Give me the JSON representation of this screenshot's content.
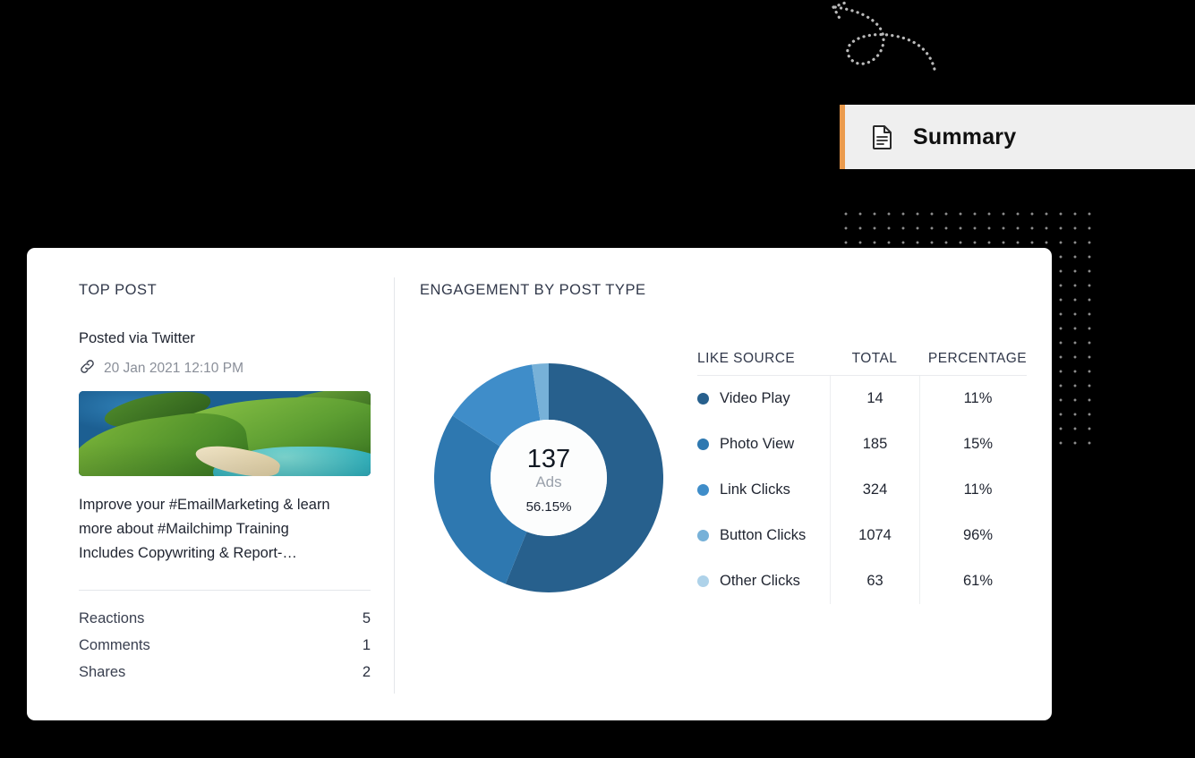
{
  "summary_tab": {
    "label": "Summary",
    "icon": "document-icon",
    "accent_color": "#eb9b4d",
    "background": "#efefef"
  },
  "card": {
    "top_post": {
      "title": "TOP POST",
      "posted_via": "Posted via Twitter",
      "link_icon": "link-icon",
      "date": "20 Jan 2021 12:10 PM",
      "thumbnail_alt": "aerial-coastline-photo",
      "text": "Improve your #EmailMarketing & learn more about #Mailchimp Training Includes Copywriting & Report-…",
      "stats": [
        {
          "label": "Reactions",
          "value": "5"
        },
        {
          "label": "Comments",
          "value": "1"
        },
        {
          "label": "Shares",
          "value": "2"
        }
      ]
    },
    "engagement": {
      "title": "ENGAGEMENT BY POST TYPE",
      "donut_center": {
        "value": "137",
        "label": "Ads",
        "percent": "56.15%"
      },
      "table": {
        "headers": {
          "source": "LIKE SOURCE",
          "total": "TOTAL",
          "percentage": "PERCENTAGE"
        },
        "rows": [
          {
            "label": "Video Play",
            "total": "14",
            "percentage": "11%",
            "color": "#27608d"
          },
          {
            "label": "Photo View",
            "total": "185",
            "percentage": "15%",
            "color": "#2e78b0"
          },
          {
            "label": "Link Clicks",
            "total": "324",
            "percentage": "11%",
            "color": "#3f8dc9"
          },
          {
            "label": "Button Clicks",
            "total": "1074",
            "percentage": "96%",
            "color": "#77b1d8"
          },
          {
            "label": "Other Clicks",
            "total": "63",
            "percentage": "61%",
            "color": "#aed2e9"
          }
        ]
      }
    }
  },
  "chart_data": {
    "type": "pie",
    "title": "ENGAGEMENT BY POST TYPE",
    "subtitle": "",
    "legend_position": "right",
    "center_value": 137,
    "center_label": "Ads",
    "center_percent": 56.15,
    "inner_arc_percent": 56.15,
    "categories": [
      "Video Play",
      "Photo View",
      "Link Clicks",
      "Button Clicks",
      "Other Clicks"
    ],
    "values": [
      14,
      185,
      324,
      1074,
      63
    ],
    "percentages": [
      11,
      15,
      11,
      96,
      61
    ],
    "slice_share_percent": [
      56.15,
      28.0,
      13.5,
      2.35,
      0
    ],
    "colors": [
      "#27608d",
      "#2e78b0",
      "#3f8dc9",
      "#77b1d8",
      "#aed2e9"
    ],
    "columns": [
      "LIKE SOURCE",
      "TOTAL",
      "PERCENTAGE"
    ]
  }
}
